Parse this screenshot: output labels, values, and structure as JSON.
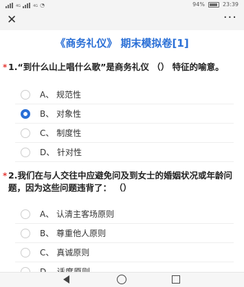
{
  "status_bar": {
    "signal_labels": [
      "4G",
      "4G"
    ],
    "battery": "94%",
    "time": "23:39"
  },
  "top_bar": {
    "close_icon": "✕",
    "more_icon": "···"
  },
  "title": "《商务礼仪》 期末模拟卷[1]",
  "questions": [
    {
      "text": "1.“到什么山上唱什么歌”是商务礼仪 （） 特征的喻意。",
      "options": [
        "A、 规范性",
        "B、 对象性",
        "C、 制度性",
        "D、 针对性"
      ],
      "selected_index": 1
    },
    {
      "text": "2.我们在与人交往中应避免问及到女士的婚姻状况或年龄问题，因为这些问题违背了： （）",
      "options": [
        "A、 认清主客场原则",
        "B、 尊重他人原则",
        "C、 真诚原则",
        "D、 适度原则"
      ],
      "selected_index": null
    }
  ],
  "required_mark": "*"
}
